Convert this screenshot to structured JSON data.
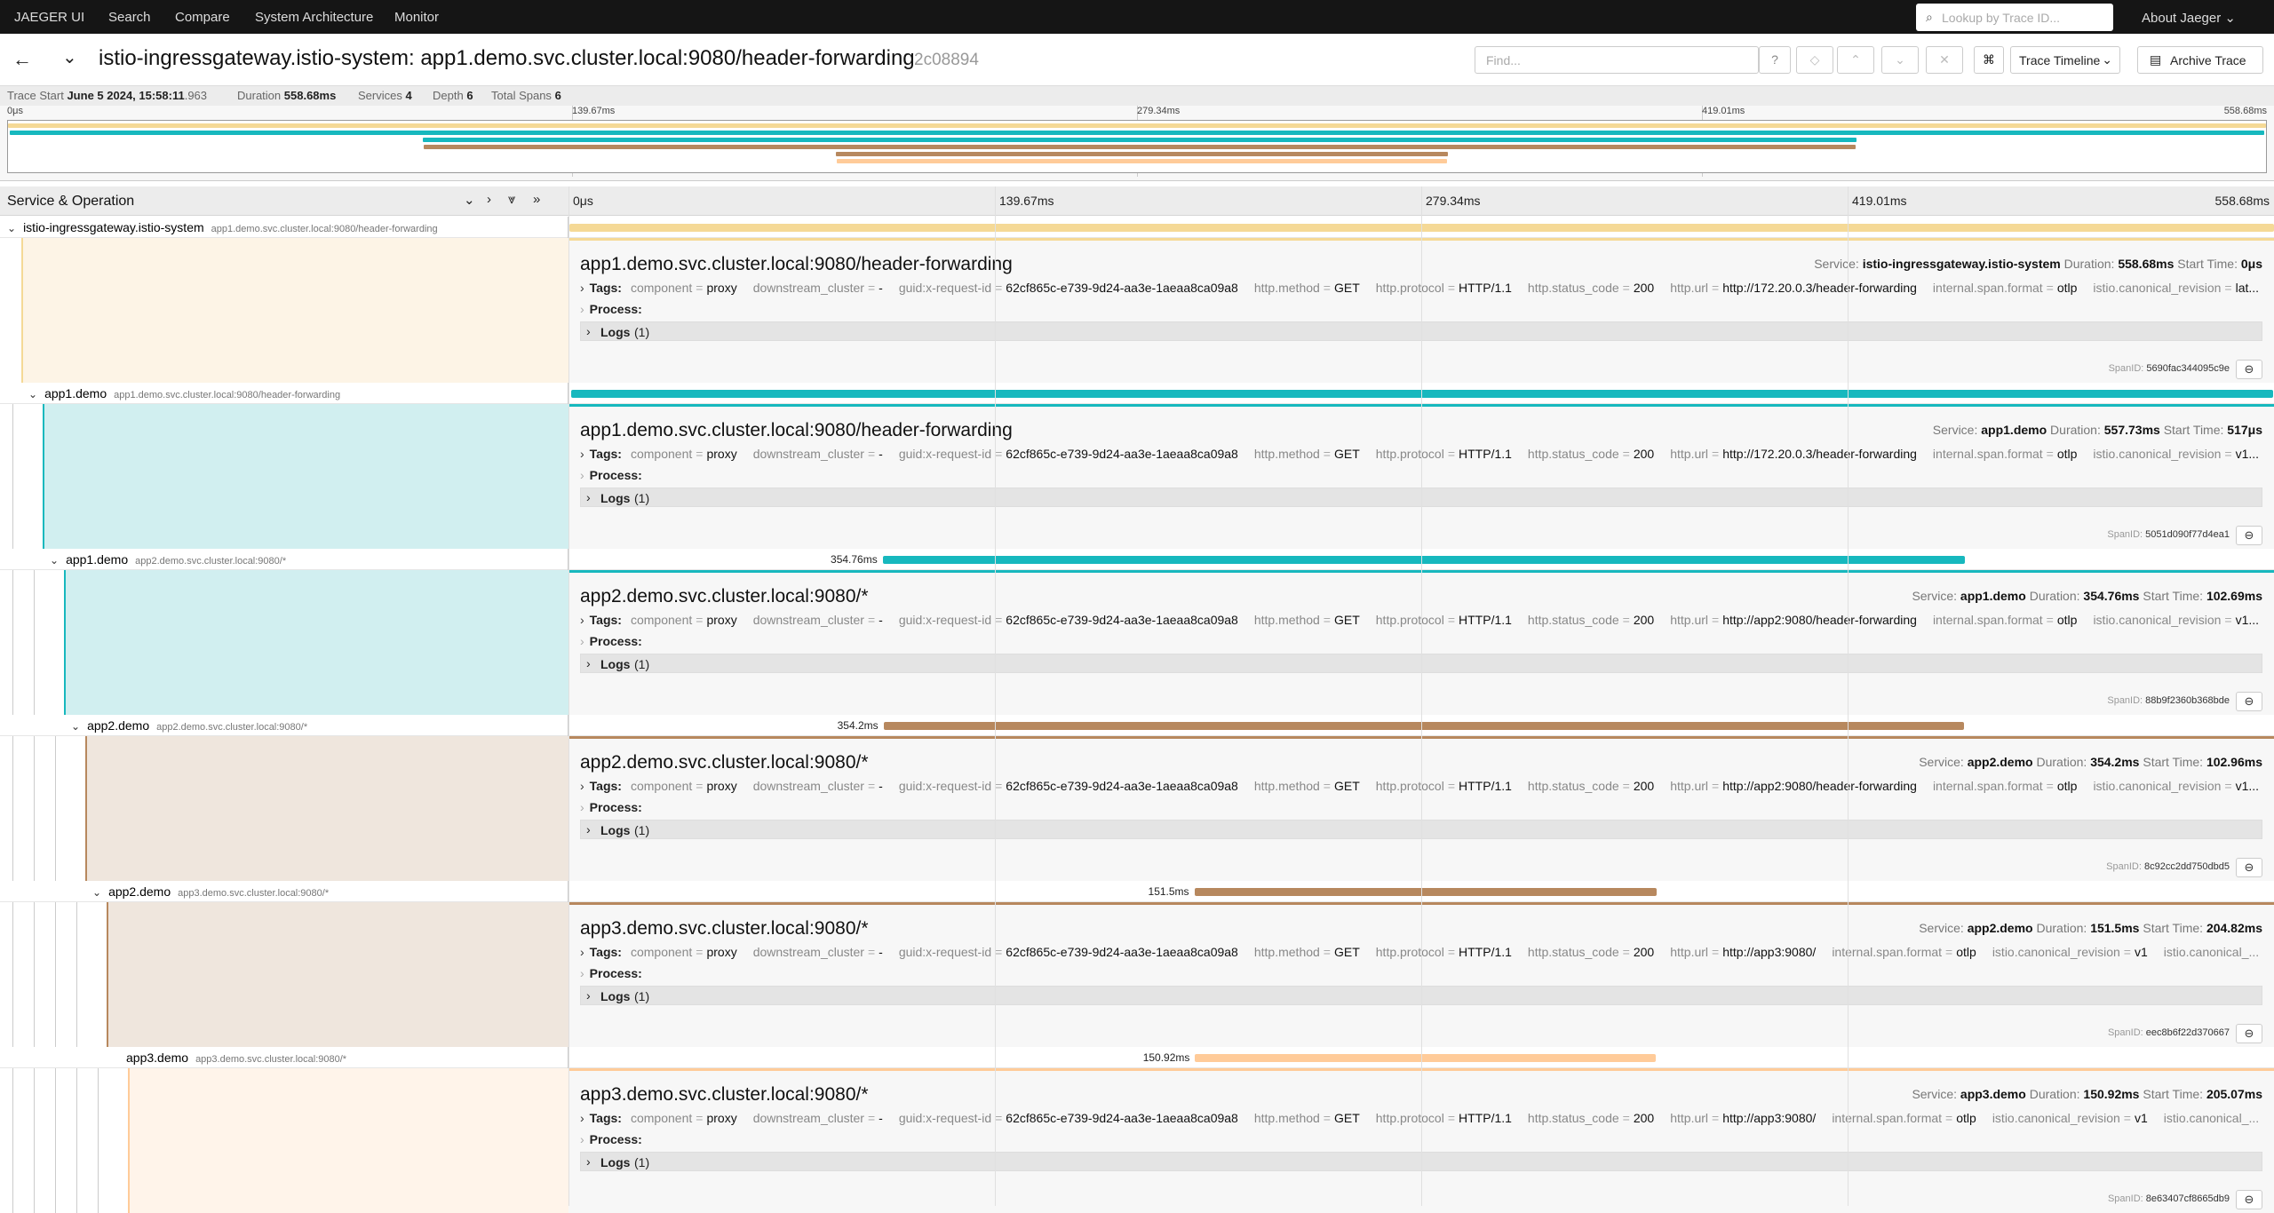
{
  "nav": {
    "brand": "JAEGER UI",
    "links": [
      "Search",
      "Compare",
      "System Architecture",
      "Monitor"
    ],
    "lookup_placeholder": "Lookup by Trace ID...",
    "about": "About Jaeger"
  },
  "title": {
    "trace_name": "istio-ingressgateway.istio-system: app1.demo.svc.cluster.local:9080/header-forwarding",
    "trace_id": "2c08894",
    "find_placeholder": "Find...",
    "view_select": "Trace Timeline",
    "archive": "Archive Trace"
  },
  "meta": {
    "trace_start_label": "Trace Start",
    "trace_start_date": "June 5 2024, 15:58:11",
    "trace_start_ms": ".963",
    "duration_label": "Duration",
    "duration": "558.68ms",
    "services_label": "Services",
    "services": "4",
    "depth_label": "Depth",
    "depth": "6",
    "total_spans_label": "Total Spans",
    "total_spans": "6"
  },
  "ticks": [
    "0μs",
    "139.67ms",
    "279.34ms",
    "419.01ms",
    "558.68ms"
  ],
  "column_header": "Service & Operation",
  "colors": {
    "istio": "#f5d996",
    "app1": "#17b8be",
    "app2": "#b7885e",
    "app3": "#ffcb99",
    "istio_bg": "#fdf4e6",
    "app1_bg": "#d1eff0",
    "app2_bg": "#efe6dd",
    "app3_bg": "#fff4ea"
  },
  "spans": [
    {
      "service": "istio-ingressgateway.istio-system",
      "operation": "app1.demo.svc.cluster.local:9080/header-forwarding",
      "title": "app1.demo.svc.cluster.local:9080/header-forwarding",
      "duration_label": "",
      "duration": "558.68ms",
      "start": "0μs",
      "start_ms": 0,
      "duration_ms": 558.68,
      "url": "http://172.20.0.3/header-forwarding",
      "tail": "istio.canonical_revision",
      "tail_value": "lat...",
      "span_id": "5690fac344095c9e"
    },
    {
      "service": "app1.demo",
      "operation": "app1.demo.svc.cluster.local:9080/header-forwarding",
      "title": "app1.demo.svc.cluster.local:9080/header-forwarding",
      "duration_label": "",
      "duration": "557.73ms",
      "start": "517μs",
      "start_ms": 0.517,
      "duration_ms": 557.73,
      "url": "http://172.20.0.3/header-forwarding",
      "tail": "istio.canonical_revision",
      "tail_value": "v1...",
      "span_id": "5051d090f77d4ea1"
    },
    {
      "service": "app1.demo",
      "operation": "app2.demo.svc.cluster.local:9080/*",
      "title": "app2.demo.svc.cluster.local:9080/*",
      "duration_label": "354.76ms",
      "duration": "354.76ms",
      "start": "102.69ms",
      "start_ms": 102.69,
      "duration_ms": 354.76,
      "url": "http://app2:9080/header-forwarding",
      "tail": "istio.canonical_revision",
      "tail_value": "v1...",
      "span_id": "88b9f2360b368bde"
    },
    {
      "service": "app2.demo",
      "operation": "app2.demo.svc.cluster.local:9080/*",
      "title": "app2.demo.svc.cluster.local:9080/*",
      "duration_label": "354.2ms",
      "duration": "354.2ms",
      "start": "102.96ms",
      "start_ms": 102.96,
      "duration_ms": 354.2,
      "url": "http://app2:9080/header-forwarding",
      "tail": "istio.canonical_revision",
      "tail_value": "v1...",
      "span_id": "8c92cc2dd750dbd5"
    },
    {
      "service": "app2.demo",
      "operation": "app3.demo.svc.cluster.local:9080/*",
      "title": "app3.demo.svc.cluster.local:9080/*",
      "duration_label": "151.5ms",
      "duration": "151.5ms",
      "start": "204.82ms",
      "start_ms": 204.82,
      "duration_ms": 151.5,
      "url": "http://app3:9080/",
      "tail": "istio.canonical_...",
      "tail_value": "",
      "span_id": "eec8b6f22d370667"
    },
    {
      "service": "app3.demo",
      "operation": "app3.demo.svc.cluster.local:9080/*",
      "title": "app3.demo.svc.cluster.local:9080/*",
      "duration_label": "150.92ms",
      "duration": "150.92ms",
      "start": "205.07ms",
      "start_ms": 205.07,
      "duration_ms": 150.92,
      "url": "http://app3:9080/",
      "tail": "istio.canonical_...",
      "tail_value": "",
      "span_id": "8e63407cf8665db9"
    }
  ],
  "tag_values": {
    "component": "proxy",
    "downstream_cluster": "-",
    "request_id": "62cf865c-e739-9d24-aa3e-1aeaa8ca09a8",
    "method": "GET",
    "protocol": "HTTP/1.1",
    "status": "200",
    "span_format": "otlp",
    "canonical_revision": "v1"
  },
  "labels": {
    "tags": "Tags:",
    "process": "Process:",
    "logs": "Logs",
    "logs_count": "(1)",
    "service": "Service:",
    "duration": "Duration:",
    "start_time": "Start Time:",
    "span_id": "SpanID:"
  }
}
